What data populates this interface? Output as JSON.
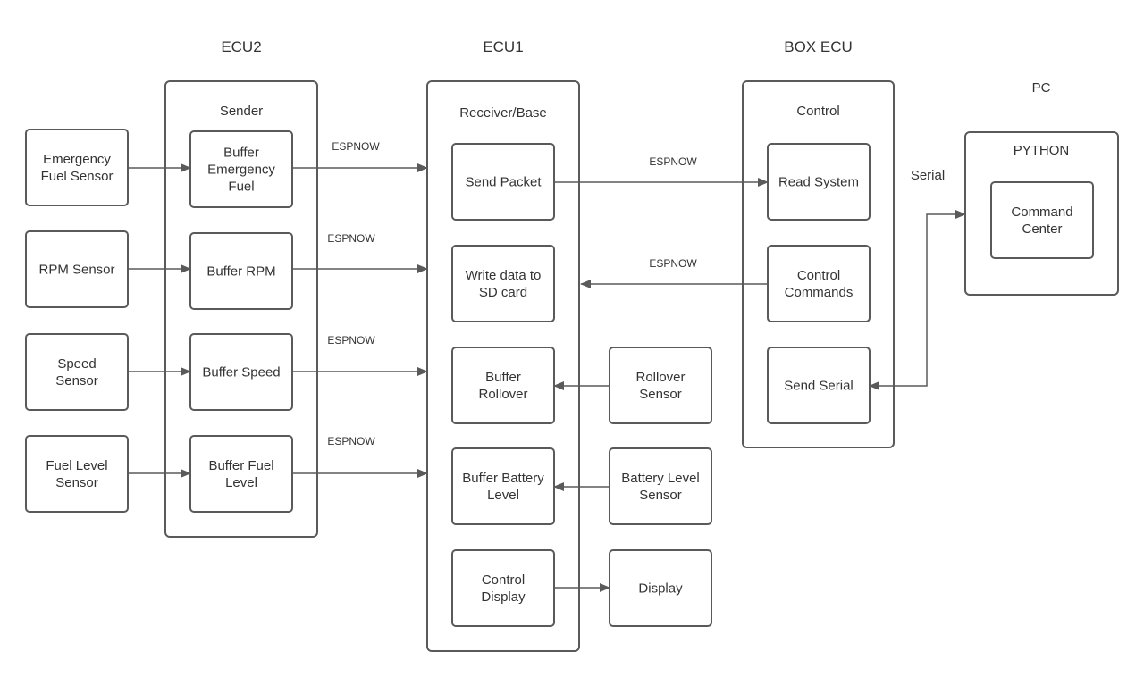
{
  "groups": {
    "ecu2": {
      "title": "ECU2",
      "subtitle": "Sender"
    },
    "ecu1": {
      "title": "ECU1",
      "subtitle": "Receiver/Base"
    },
    "box_ecu": {
      "title": "BOX ECU",
      "subtitle": "Control"
    },
    "pc": {
      "title": "PC",
      "subtitle": "PYTHON"
    }
  },
  "nodes": {
    "emergency_fuel_sensor": [
      "Emergency",
      "Fuel  Sensor"
    ],
    "rpm_sensor": [
      "RPM Sensor"
    ],
    "speed_sensor": [
      "Speed",
      "Sensor"
    ],
    "fuel_level_sensor": [
      "Fuel Level",
      "Sensor"
    ],
    "buffer_emergency_fuel": [
      "Buffer",
      "Emergency",
      "Fuel"
    ],
    "buffer_rpm": [
      "Buffer RPM"
    ],
    "buffer_speed": [
      "Buffer Speed"
    ],
    "buffer_fuel_level": [
      "Buffer Fuel",
      "Level"
    ],
    "send_packet": [
      "Send Packet"
    ],
    "write_sd": [
      "Write data to",
      "SD card"
    ],
    "buffer_rollover": [
      "Buffer",
      "Rollover"
    ],
    "buffer_battery": [
      "Buffer Battery",
      "Level"
    ],
    "control_display": [
      "Control",
      "Display"
    ],
    "rollover_sensor": [
      "Rollover",
      "Sensor"
    ],
    "battery_sensor": [
      "Battery Level",
      "Sensor"
    ],
    "display": [
      "Display"
    ],
    "read_system": [
      "Read System"
    ],
    "control_commands": [
      "Control",
      "Commands"
    ],
    "send_serial": [
      "Send Serial"
    ],
    "command_center": [
      "Command",
      "Center"
    ]
  },
  "edge_labels": {
    "espnow": "ESPNOW",
    "serial": "Serial"
  },
  "colors": {
    "stroke": "#5a5a5a",
    "text": "#333333",
    "background": "#ffffff"
  }
}
